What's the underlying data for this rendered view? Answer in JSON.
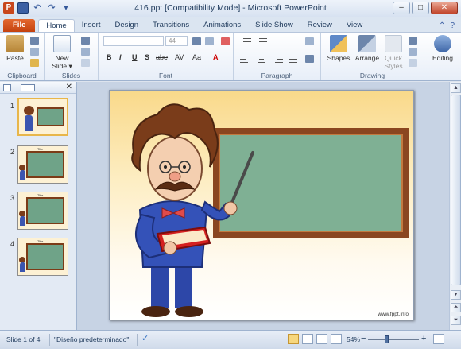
{
  "window": {
    "title": "416.ppt [Compatibility Mode] - Microsoft PowerPoint",
    "app_icon": "P",
    "controls": [
      "–",
      "□",
      "✕"
    ]
  },
  "tabs": [
    "File",
    "Home",
    "Insert",
    "Design",
    "Transitions",
    "Animations",
    "Slide Show",
    "Review",
    "View"
  ],
  "ribbon": {
    "clipboard": {
      "paste_label": "Paste",
      "group_label": "Clipboard"
    },
    "slides": {
      "new_slide_label": "New Slide",
      "new_slide_arrow": "▾",
      "group_label": "Slides"
    },
    "font": {
      "font_name": "",
      "font_size": "44",
      "buttons": [
        "B",
        "I",
        "U",
        "S",
        "abe",
        "AV",
        "Aa",
        "A"
      ],
      "group_label": "Font"
    },
    "paragraph": {
      "group_label": "Paragraph"
    },
    "drawing": {
      "shapes_label": "Shapes",
      "arrange_label": "Arrange",
      "quick_styles_label": "Quick Styles",
      "group_label": "Drawing"
    },
    "editing": {
      "label": "Editing"
    }
  },
  "thumbnails": [
    {
      "number": "1",
      "label": ""
    },
    {
      "number": "2",
      "label": "Title"
    },
    {
      "number": "3",
      "label": "Title"
    },
    {
      "number": "4",
      "label": "Title"
    }
  ],
  "slide": {
    "credit": "www.fppt.info"
  },
  "status": {
    "slide_info": "Slide 1 of 4",
    "theme": "\"Diseño predeterminado\"",
    "zoom": "54%",
    "zoom_minus": "−",
    "zoom_plus": "+"
  },
  "colors": {
    "file_tab": "#c4420f",
    "chalkboard": "#7fb094",
    "board_frame": "#8a4620",
    "slide_top": "#f9d98a"
  }
}
